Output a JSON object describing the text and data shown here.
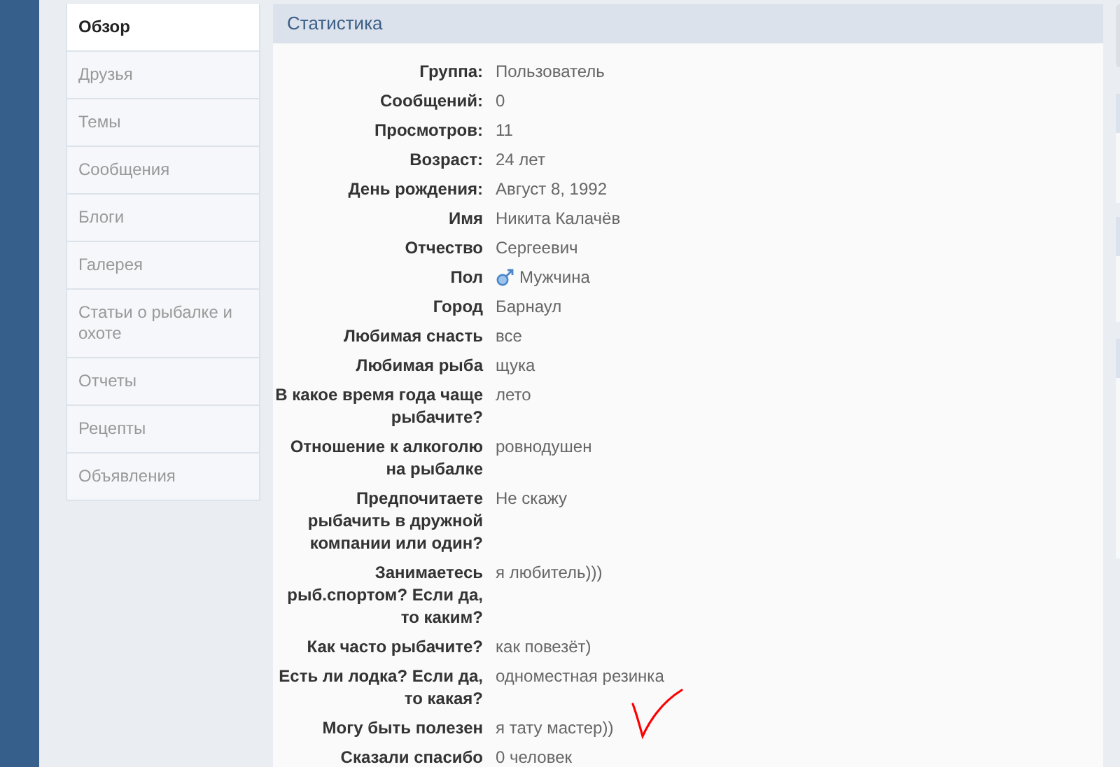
{
  "sidebar": {
    "items": [
      {
        "label": "Обзор",
        "selected": true
      },
      {
        "label": "Друзья",
        "selected": false
      },
      {
        "label": "Темы",
        "selected": false
      },
      {
        "label": "Сообщения",
        "selected": false
      },
      {
        "label": "Блоги",
        "selected": false
      },
      {
        "label": "Галерея",
        "selected": false
      },
      {
        "label": "Статьи о рыбалке и охоте",
        "selected": false
      },
      {
        "label": "Отчеты",
        "selected": false
      },
      {
        "label": "Рецепты",
        "selected": false
      },
      {
        "label": "Объявления",
        "selected": false
      }
    ]
  },
  "stats": {
    "title": "Статистика",
    "rows": [
      {
        "label": "Группа:",
        "value": "Пользователь",
        "kind": "text"
      },
      {
        "label": "Сообщений:",
        "value": "0",
        "kind": "text"
      },
      {
        "label": "Просмотров:",
        "value": "11",
        "kind": "text"
      },
      {
        "label": "Возраст:",
        "value": "24 лет",
        "kind": "text"
      },
      {
        "label": "День рождения:",
        "value": "Август 8, 1992",
        "kind": "text"
      },
      {
        "label": "Имя",
        "value": "Никита Калачёв",
        "kind": "text"
      },
      {
        "label": "Отчество",
        "value": "Сергеевич",
        "kind": "text"
      },
      {
        "label": "Пол",
        "value": "Мужчина",
        "kind": "gender"
      },
      {
        "label": "Город",
        "value": "Барнаул",
        "kind": "text"
      },
      {
        "label": "Любимая снасть",
        "value": "все",
        "kind": "text"
      },
      {
        "label": "Любимая рыба",
        "value": "щука",
        "kind": "text"
      },
      {
        "label": "В какое время года чаще рыбачите?",
        "value": "лето",
        "kind": "text"
      },
      {
        "label": "Отношение к алкоголю на рыбалке",
        "value": "ровнодушен",
        "kind": "text"
      },
      {
        "label": "Предпочитаете рыбачить в дружной компании или один?",
        "value": "Не скажу",
        "kind": "text"
      },
      {
        "label": "Занимаетесь рыб.спортом? Если да, то каким?",
        "value": "я любитель)))",
        "kind": "text"
      },
      {
        "label": "Как часто рыбачите?",
        "value": "как повезёт)",
        "kind": "text"
      },
      {
        "label": "Есть ли лодка? Если да, то какая?",
        "value": "одноместная резинка",
        "kind": "text"
      },
      {
        "label": "Могу быть полезен",
        "value": "я тату мастер))",
        "kind": "text"
      },
      {
        "label": "Сказали спасибо",
        "value": "0 человек",
        "kind": "text"
      }
    ]
  }
}
